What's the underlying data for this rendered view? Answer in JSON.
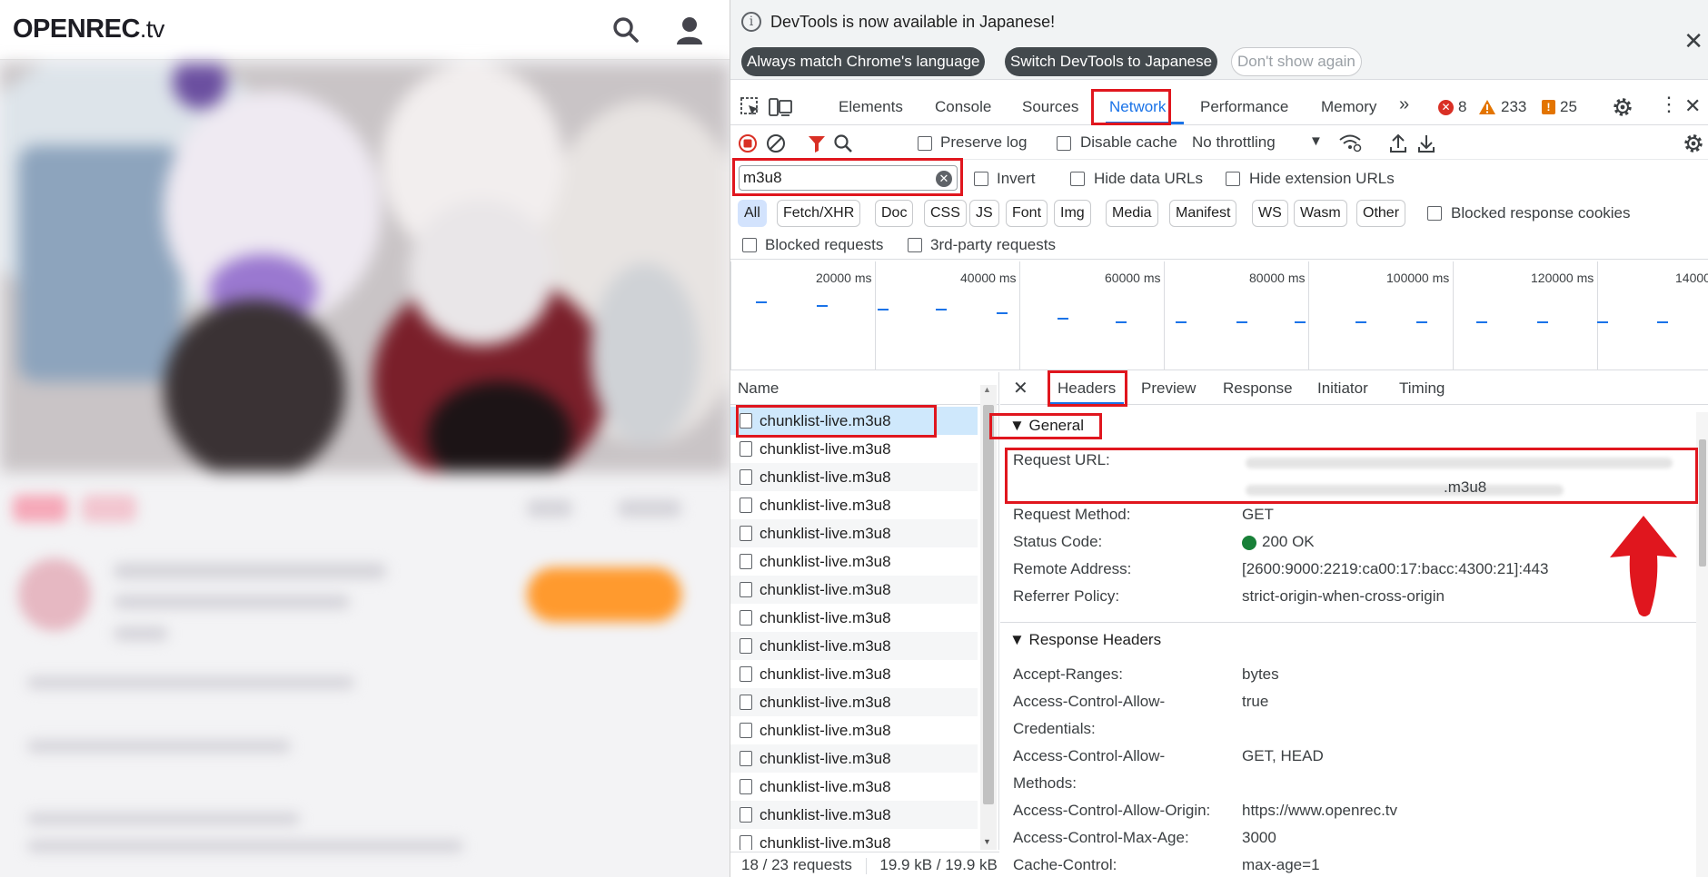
{
  "site": {
    "logo_main": "OPENREC",
    "logo_suffix": ".tv"
  },
  "infobar": {
    "message": "DevTools is now available in Japanese!",
    "btn_match": "Always match Chrome's language",
    "btn_switch": "Switch DevTools to Japanese",
    "btn_dont_show": "Don't show again",
    "close": "✕"
  },
  "tabs": {
    "items": [
      "Elements",
      "Console",
      "Sources",
      "Network",
      "Performance",
      "Memory"
    ],
    "more": "»",
    "errors": "8",
    "warnings": "233",
    "issues": "25",
    "active": "Network"
  },
  "toolbar": {
    "preserve_log": "Preserve log",
    "disable_cache": "Disable cache",
    "throttling": "No throttling"
  },
  "filter": {
    "value": "m3u8",
    "invert": "Invert",
    "hide_data_urls": "Hide data URLs",
    "hide_extension_urls": "Hide extension URLs",
    "types": [
      "All",
      "Fetch/XHR",
      "Doc",
      "CSS",
      "JS",
      "Font",
      "Img",
      "Media",
      "Manifest",
      "WS",
      "Wasm",
      "Other"
    ],
    "blocked_response_cookies": "Blocked response cookies",
    "blocked_requests": "Blocked requests",
    "third_party": "3rd-party requests"
  },
  "timeline": {
    "ticks": [
      "20000 ms",
      "40000 ms",
      "60000 ms",
      "80000 ms",
      "100000 ms",
      "120000 ms",
      "14000"
    ]
  },
  "list": {
    "header": "Name",
    "rows": [
      "chunklist-live.m3u8",
      "chunklist-live.m3u8",
      "chunklist-live.m3u8",
      "chunklist-live.m3u8",
      "chunklist-live.m3u8",
      "chunklist-live.m3u8",
      "chunklist-live.m3u8",
      "chunklist-live.m3u8",
      "chunklist-live.m3u8",
      "chunklist-live.m3u8",
      "chunklist-live.m3u8",
      "chunklist-live.m3u8",
      "chunklist-live.m3u8",
      "chunklist-live.m3u8",
      "chunklist-live.m3u8",
      "chunklist-live.m3u8"
    ]
  },
  "status": {
    "requests": "18 / 23 requests",
    "transferred": "19.9 kB / 19.9 kB"
  },
  "details": {
    "close": "✕",
    "tabs": [
      "Headers",
      "Preview",
      "Response",
      "Initiator",
      "Timing"
    ],
    "general_title": "▼ General",
    "general": [
      {
        "k": "Request URL:",
        "v": ".m3u8"
      },
      {
        "k": "Request Method:",
        "v": "GET"
      },
      {
        "k": "Status Code:",
        "v": "200 OK"
      },
      {
        "k": "Remote Address:",
        "v": "[2600:9000:2219:ca00:17:bacc:4300:21]:443"
      },
      {
        "k": "Referrer Policy:",
        "v": "strict-origin-when-cross-origin"
      }
    ],
    "response_title": "▼ Response Headers",
    "response": [
      {
        "k": "Accept-Ranges:",
        "v": "bytes"
      },
      {
        "k": "Access-Control-Allow-",
        "k2": "Credentials:",
        "v": "true"
      },
      {
        "k": "Access-Control-Allow-",
        "k2": "Methods:",
        "v": "GET, HEAD"
      },
      {
        "k": "Access-Control-Allow-Origin:",
        "v": "https://www.openrec.tv"
      },
      {
        "k": "Access-Control-Max-Age:",
        "v": "3000"
      },
      {
        "k": "Cache-Control:",
        "v": "max-age=1"
      }
    ]
  },
  "colors": {
    "highlight": "#e0161e",
    "status_ok": "#188038",
    "arrow": "#e0161e"
  }
}
